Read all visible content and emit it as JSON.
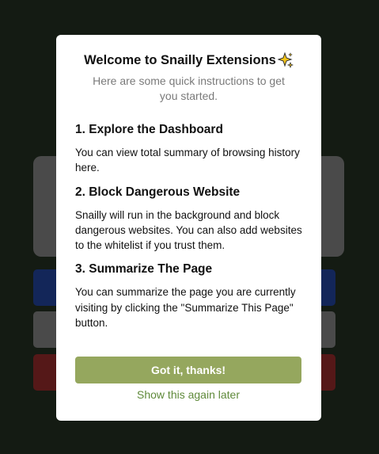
{
  "colors": {
    "page_background": "#141b13",
    "modal_background": "#ffffff",
    "primary_button": "#95a75e",
    "secondary_link": "#5f8a3a",
    "subtitle": "#7a7a7a",
    "bg_card": "#4a4a4a",
    "bg_blue_button": "#132659",
    "bg_gray_button": "#4a4a4a",
    "bg_red_button": "#551818"
  },
  "modal": {
    "title": "Welcome to Snailly Extensions",
    "title_icon": "sparkle-icon",
    "subtitle": "Here are some quick instructions to get you started.",
    "sections": [
      {
        "title": "1. Explore the Dashboard",
        "text": "You can view total summary of browsing history here."
      },
      {
        "title": "2. Block Dangerous Website",
        "text": "Snailly will run in the background and block dangerous websites. You can also add websites to the whitelist if you trust them."
      },
      {
        "title": "3. Summarize The Page",
        "text": "You can summarize the page you are currently visiting by clicking the \"Summarize This Page\" button."
      }
    ],
    "primary_button_label": "Got it, thanks!",
    "secondary_link_label": "Show this again later"
  }
}
